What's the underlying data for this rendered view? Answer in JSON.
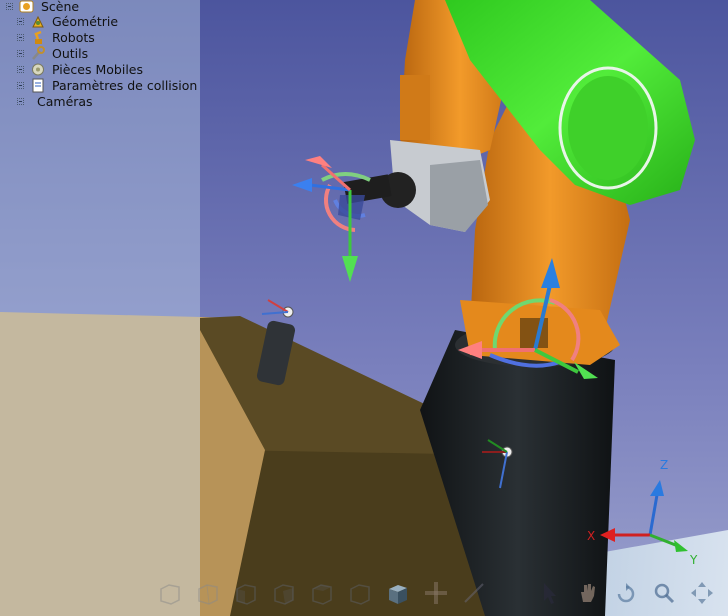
{
  "scene_tree": {
    "root": {
      "label": "Scène",
      "icon": "scene-icon"
    },
    "items": [
      {
        "label": "Géométrie",
        "icon": "geometry-icon"
      },
      {
        "label": "Robots",
        "icon": "robots-icon"
      },
      {
        "label": "Outils",
        "icon": "tools-icon"
      },
      {
        "label": "Pièces Mobiles",
        "icon": "moving-parts-icon"
      },
      {
        "label": "Paramètres de collision",
        "icon": "collision-settings-icon"
      },
      {
        "label": "Caméras",
        "icon": ""
      }
    ]
  },
  "axis_triad": {
    "z": "Z",
    "x": "X",
    "y": "Y"
  },
  "colors": {
    "robot_orange": "#e8891a",
    "robot_green": "#3ee02a",
    "sky_top": "#5a63a8",
    "floor": "#c8a468",
    "block_dark": "#4c3f1e",
    "pedestal": "#1d2124"
  },
  "toolbar": {
    "icons": [
      "view-front-icon",
      "view-back-icon",
      "view-left-icon",
      "view-right-icon",
      "view-top-icon",
      "view-bottom-icon",
      "view-iso-icon",
      "measure-icon",
      "pointer-icon",
      "hand-icon",
      "rotate-icon",
      "zoom-icon",
      "fit-icon"
    ]
  }
}
